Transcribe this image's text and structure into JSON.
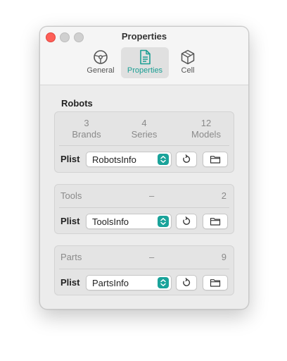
{
  "window": {
    "title": "Properties"
  },
  "tabs": [
    {
      "label": "General",
      "icon": "steering-wheel-icon"
    },
    {
      "label": "Properties",
      "icon": "document-icon",
      "selected": true
    },
    {
      "label": "Cell",
      "icon": "cube-icon"
    }
  ],
  "robots": {
    "title": "Robots",
    "stats": [
      {
        "value": "3",
        "label": "Brands"
      },
      {
        "value": "4",
        "label": "Series"
      },
      {
        "value": "12",
        "label": "Models"
      }
    ],
    "plist_label": "Plist",
    "plist_value": "RobotsInfo"
  },
  "tools": {
    "name": "Tools",
    "dash": "–",
    "count": "2",
    "plist_label": "Plist",
    "plist_value": "ToolsInfo"
  },
  "parts": {
    "name": "Parts",
    "dash": "–",
    "count": "9",
    "plist_label": "Plist",
    "plist_value": "PartsInfo"
  },
  "colors": {
    "accent": "#1aa39a",
    "close": "#fe5f57",
    "inactive_traffic": "#d0d0d0"
  }
}
